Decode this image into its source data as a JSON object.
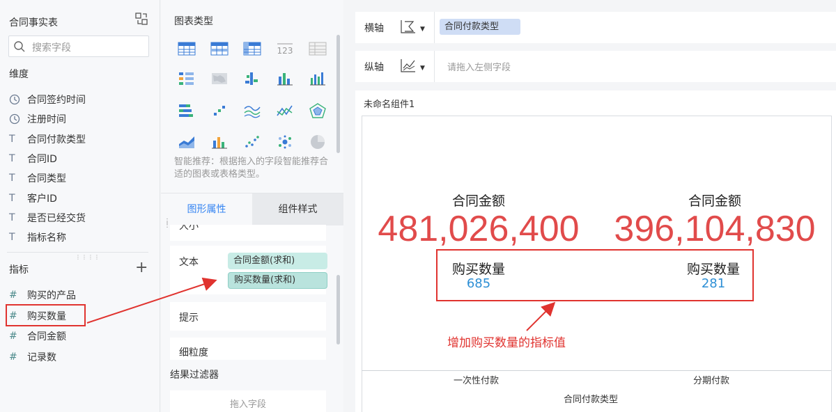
{
  "field_panel": {
    "title": "合同事实表",
    "search_placeholder": "搜索字段",
    "dimensions_title": "维度",
    "dimensions": [
      {
        "icon": "clock-icon",
        "label": "合同签约时间"
      },
      {
        "icon": "clock-icon",
        "label": "注册时间"
      },
      {
        "icon": "text-type-icon",
        "label": "合同付款类型"
      },
      {
        "icon": "text-type-icon",
        "label": "合同ID"
      },
      {
        "icon": "text-type-icon",
        "label": "合同类型"
      },
      {
        "icon": "text-type-icon",
        "label": "客户ID"
      },
      {
        "icon": "text-type-icon",
        "label": "是否已经交货"
      },
      {
        "icon": "text-type-icon",
        "label": "指标名称"
      }
    ],
    "measures_title": "指标",
    "measures": [
      {
        "icon": "number-type-icon",
        "label": "购买的产品"
      },
      {
        "icon": "number-type-icon",
        "label": "购买数量"
      },
      {
        "icon": "number-type-icon",
        "label": "合同金额"
      },
      {
        "icon": "number-type-icon",
        "label": "记录数"
      }
    ]
  },
  "chart_panel": {
    "title": "图表类型",
    "hint": "智能推荐：根据拖入的字段智能推荐合适的图表或表格类型。",
    "tabs": [
      "图形属性",
      "组件样式"
    ],
    "properties": {
      "text_label": "文本",
      "text_fields": [
        "合同金额(求和)",
        "购买数量(求和)"
      ],
      "tooltip_label": "提示",
      "granularity_label": "细粒度"
    },
    "filter_title": "结果过滤器",
    "filter_drop": "拖入字段"
  },
  "axes": {
    "x_label": "横轴",
    "x_field": "合同付款类型",
    "y_label": "纵轴",
    "y_placeholder": "请拖入左侧字段"
  },
  "widget": {
    "name": "未命名组件1",
    "kpis": [
      {
        "label": "合同金额",
        "value": "481,026,400",
        "sub_label": "购买数量",
        "sub_value": "685",
        "category": "一次性付款"
      },
      {
        "label": "合同金额",
        "value": "396,104,830",
        "sub_label": "购买数量",
        "sub_value": "281",
        "category": "分期付款"
      }
    ],
    "x_title": "合同付款类型",
    "annotation": "增加购买数量的指标值"
  },
  "colors": {
    "accent": "#3685f2",
    "kpi_value": "#e14b4b",
    "sub_value": "#2d8fd5",
    "annotation": "#e0332f",
    "pill": "#c8ece6",
    "axis_tag": "#cfddf5"
  }
}
